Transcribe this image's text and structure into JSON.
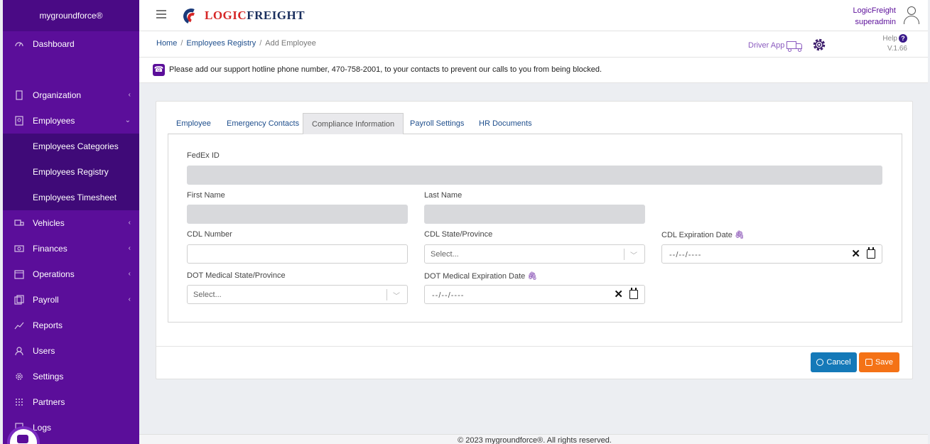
{
  "sidebar": {
    "brand": "mygroundforce®",
    "items": [
      {
        "label": "Dashboard",
        "icon": "dashboard-icon",
        "chevron": ""
      },
      {
        "label": "Organization",
        "icon": "building-icon",
        "chevron": "‹"
      },
      {
        "label": "Employees",
        "icon": "id-card-icon",
        "chevron": "⌄"
      },
      {
        "label": "Vehicles",
        "icon": "truck-icon",
        "chevron": "‹"
      },
      {
        "label": "Finances",
        "icon": "money-icon",
        "chevron": "‹"
      },
      {
        "label": "Operations",
        "icon": "calendar-icon",
        "chevron": "‹"
      },
      {
        "label": "Payroll",
        "icon": "payroll-icon",
        "chevron": "‹"
      },
      {
        "label": "Reports",
        "icon": "chart-icon",
        "chevron": ""
      },
      {
        "label": "Users",
        "icon": "users-icon",
        "chevron": ""
      },
      {
        "label": "Settings",
        "icon": "gear-icon",
        "chevron": ""
      },
      {
        "label": "Partners",
        "icon": "grid-icon",
        "chevron": ""
      },
      {
        "label": "Logs",
        "icon": "log-icon",
        "chevron": ""
      }
    ],
    "employee_sub": [
      "Employees Categories",
      "Employees Registry",
      "Employees Timesheet"
    ]
  },
  "topbar": {
    "logo_part1": "LOGIC",
    "logo_part2": "FREIGHT",
    "company": "LogicFreight",
    "role": "superadmin"
  },
  "breadcrumb": {
    "home": "Home",
    "registry": "Employees Registry",
    "current": "Add Employee",
    "sep": "/"
  },
  "actions": {
    "driver_app": "Driver App",
    "help": "Help",
    "help_q": "?",
    "version": "V.1.66"
  },
  "notice": {
    "icon": "☎",
    "text": "Please add our support hotline phone number, 470-758-2001, to your contacts to prevent our calls to you from being blocked."
  },
  "tabs": [
    "Employee",
    "Emergency Contacts",
    "Compliance Information",
    "Payroll Settings",
    "HR Documents"
  ],
  "form": {
    "fedex_id": "FedEx ID",
    "first_name": "First Name",
    "last_name": "Last Name",
    "cdl_number": "CDL Number",
    "cdl_state": "CDL State/Province",
    "cdl_expiration": "CDL Expiration Date",
    "dot_state": "DOT Medical State/Province",
    "dot_expiration": "DOT Medical Expiration Date",
    "select_placeholder": "Select...",
    "date_placeholder": "--/--/----",
    "clear": "✕"
  },
  "buttons": {
    "cancel": "Cancel",
    "save": "Save"
  },
  "footer": "© 2023 mygroundforce®. All rights reserved.",
  "colors": {
    "sidebar": "#5b0e9a",
    "cancel": "#1479b8",
    "save": "#f47216"
  }
}
